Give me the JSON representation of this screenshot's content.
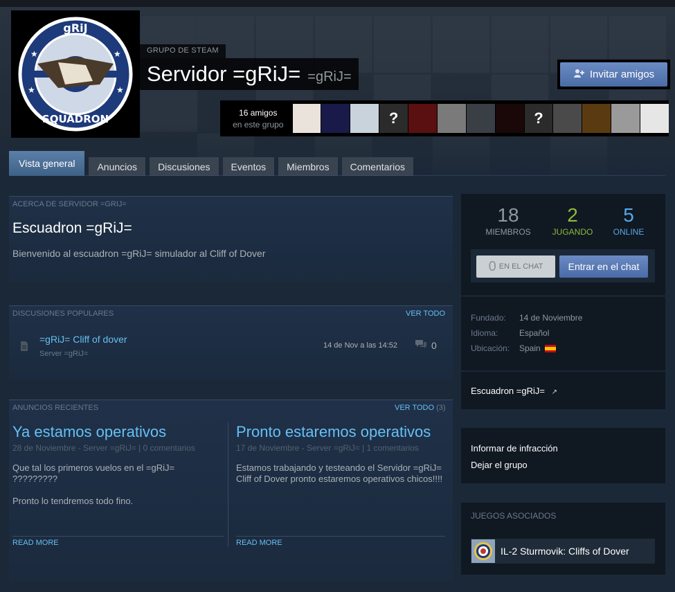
{
  "header": {
    "group_type": "GRUPO DE STEAM",
    "title": "Servidor =gRiJ=",
    "tag": "=gRiJ=",
    "invite_label": "Invitar amigos",
    "friends_count": "16 amigos",
    "friends_suffix": "en este grupo",
    "friend_placeholders": [
      "?",
      "?"
    ]
  },
  "tabs": [
    "Vista general",
    "Anuncios",
    "Discusiones",
    "Eventos",
    "Miembros",
    "Comentarios"
  ],
  "about": {
    "heading": "ACERCA DE SERVIDOR =GRIJ=",
    "title": "Escuadron =gRiJ=",
    "description": "Bienvenido al escuadron =gRiJ= simulador al Cliff of Dover"
  },
  "discussions": {
    "heading": "DISCUSIONES POPULARES",
    "view_all": "VER TODO",
    "items": [
      {
        "title": "=gRiJ= Cliff of dover",
        "sub": "Server =gRiJ=",
        "date": "14 de Nov a las 14:52",
        "comments": "0"
      }
    ]
  },
  "announcements": {
    "heading": "ANUNCIOS RECIENTES",
    "view_all": "VER TODO",
    "count": "(3)",
    "read_more": "READ MORE",
    "items": [
      {
        "title": "Ya estamos operativos",
        "meta": "28 de Noviembre - Server =gRiJ= | 0 comentarios",
        "body": "Que tal los primeros vuelos en el =gRiJ= ?????????\n\nPronto lo tendremos todo fino."
      },
      {
        "title": "Pronto estaremos operativos",
        "meta": "17 de Noviembre - Server =gRiJ= | 1 comentarios",
        "body": "Estamos trabajando y testeando el Servidor =gRiJ= Cliff of Dover pronto estaremos operativos chicos!!!!"
      }
    ]
  },
  "stats": {
    "members": {
      "value": "18",
      "label": "MIEMBROS",
      "color": "#8f98a0"
    },
    "playing": {
      "value": "2",
      "label": "JUGANDO",
      "color": "#90ba3c"
    },
    "online": {
      "value": "5",
      "label": "ONLINE",
      "color": "#57a8e8"
    }
  },
  "chat": {
    "count": "0",
    "count_label": "EN EL CHAT",
    "button": "Entrar en el chat"
  },
  "info": {
    "founded_label": "Fundado:",
    "founded": "14 de Noviembre",
    "language_label": "Idioma:",
    "language": "Español",
    "location_label": "Ubicación:",
    "location": "Spain"
  },
  "group_link": "Escuadron =gRiJ=",
  "actions": {
    "report": "Informar de infracción",
    "leave": "Dejar el grupo"
  },
  "games": {
    "heading": "JUEGOS ASOCIADOS",
    "items": [
      "IL-2 Sturmovik: Cliffs of Dover"
    ]
  },
  "logo": {
    "top_text": "gRiJ",
    "bottom_text": "SQUADRON"
  }
}
